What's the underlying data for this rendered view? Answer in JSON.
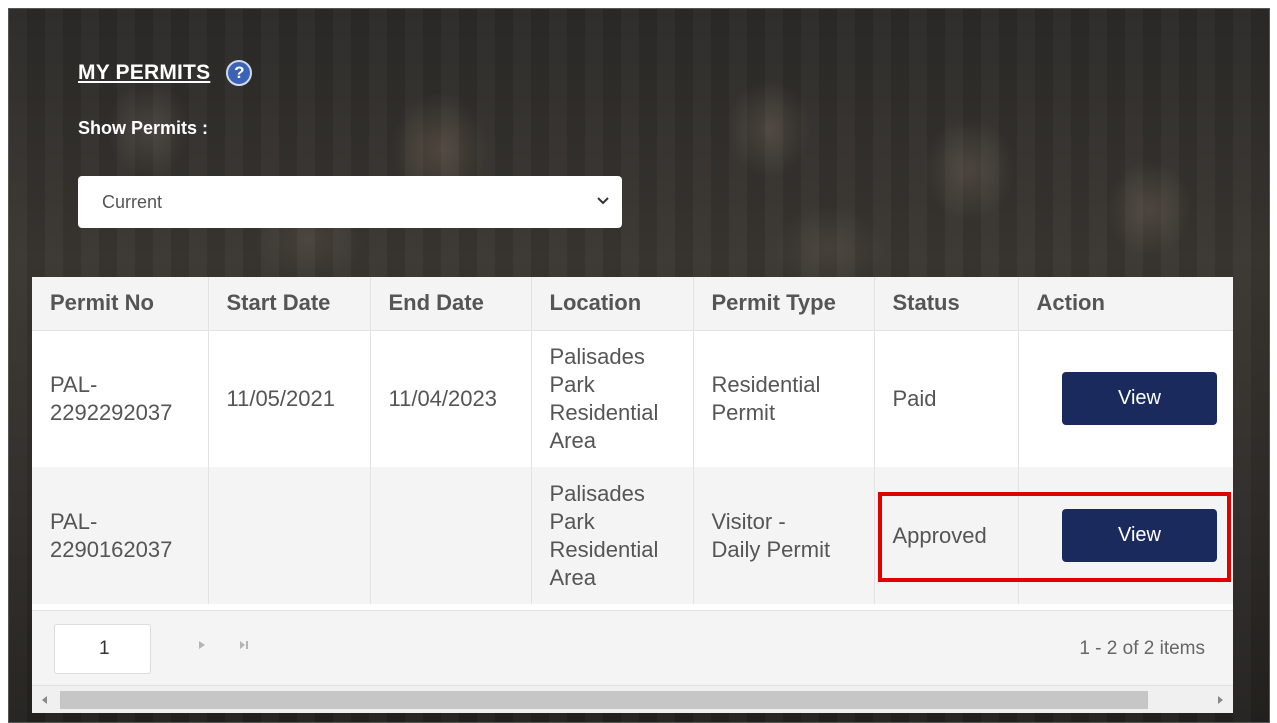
{
  "page": {
    "title": "MY PERMITS",
    "help_icon": "?",
    "filter_label": "Show Permits :",
    "filter_selected": "Current"
  },
  "table": {
    "columns": [
      "Permit No",
      "Start Date",
      "End Date",
      "Location",
      "Permit Type",
      "Status",
      "Action"
    ],
    "rows": [
      {
        "permit_no": "PAL-\n2292292037",
        "start_date": "11/05/2021",
        "end_date": "11/04/2023",
        "location": "Palisades\nPark\nResidential\nArea",
        "permit_type": "Residential\nPermit",
        "status": "Paid",
        "action": "View"
      },
      {
        "permit_no": "PAL-\n2290162037",
        "start_date": "",
        "end_date": "",
        "location": "Palisades\nPark\nResidential\nArea",
        "permit_type": "Visitor -\nDaily Permit",
        "status": "Approved",
        "action": "View"
      }
    ]
  },
  "pager": {
    "current_page": "1",
    "items_info": "1 - 2 of 2 items"
  },
  "colors": {
    "button": "#1b2a5c",
    "help_icon": "#3c63b5",
    "highlight": "#e00000"
  }
}
